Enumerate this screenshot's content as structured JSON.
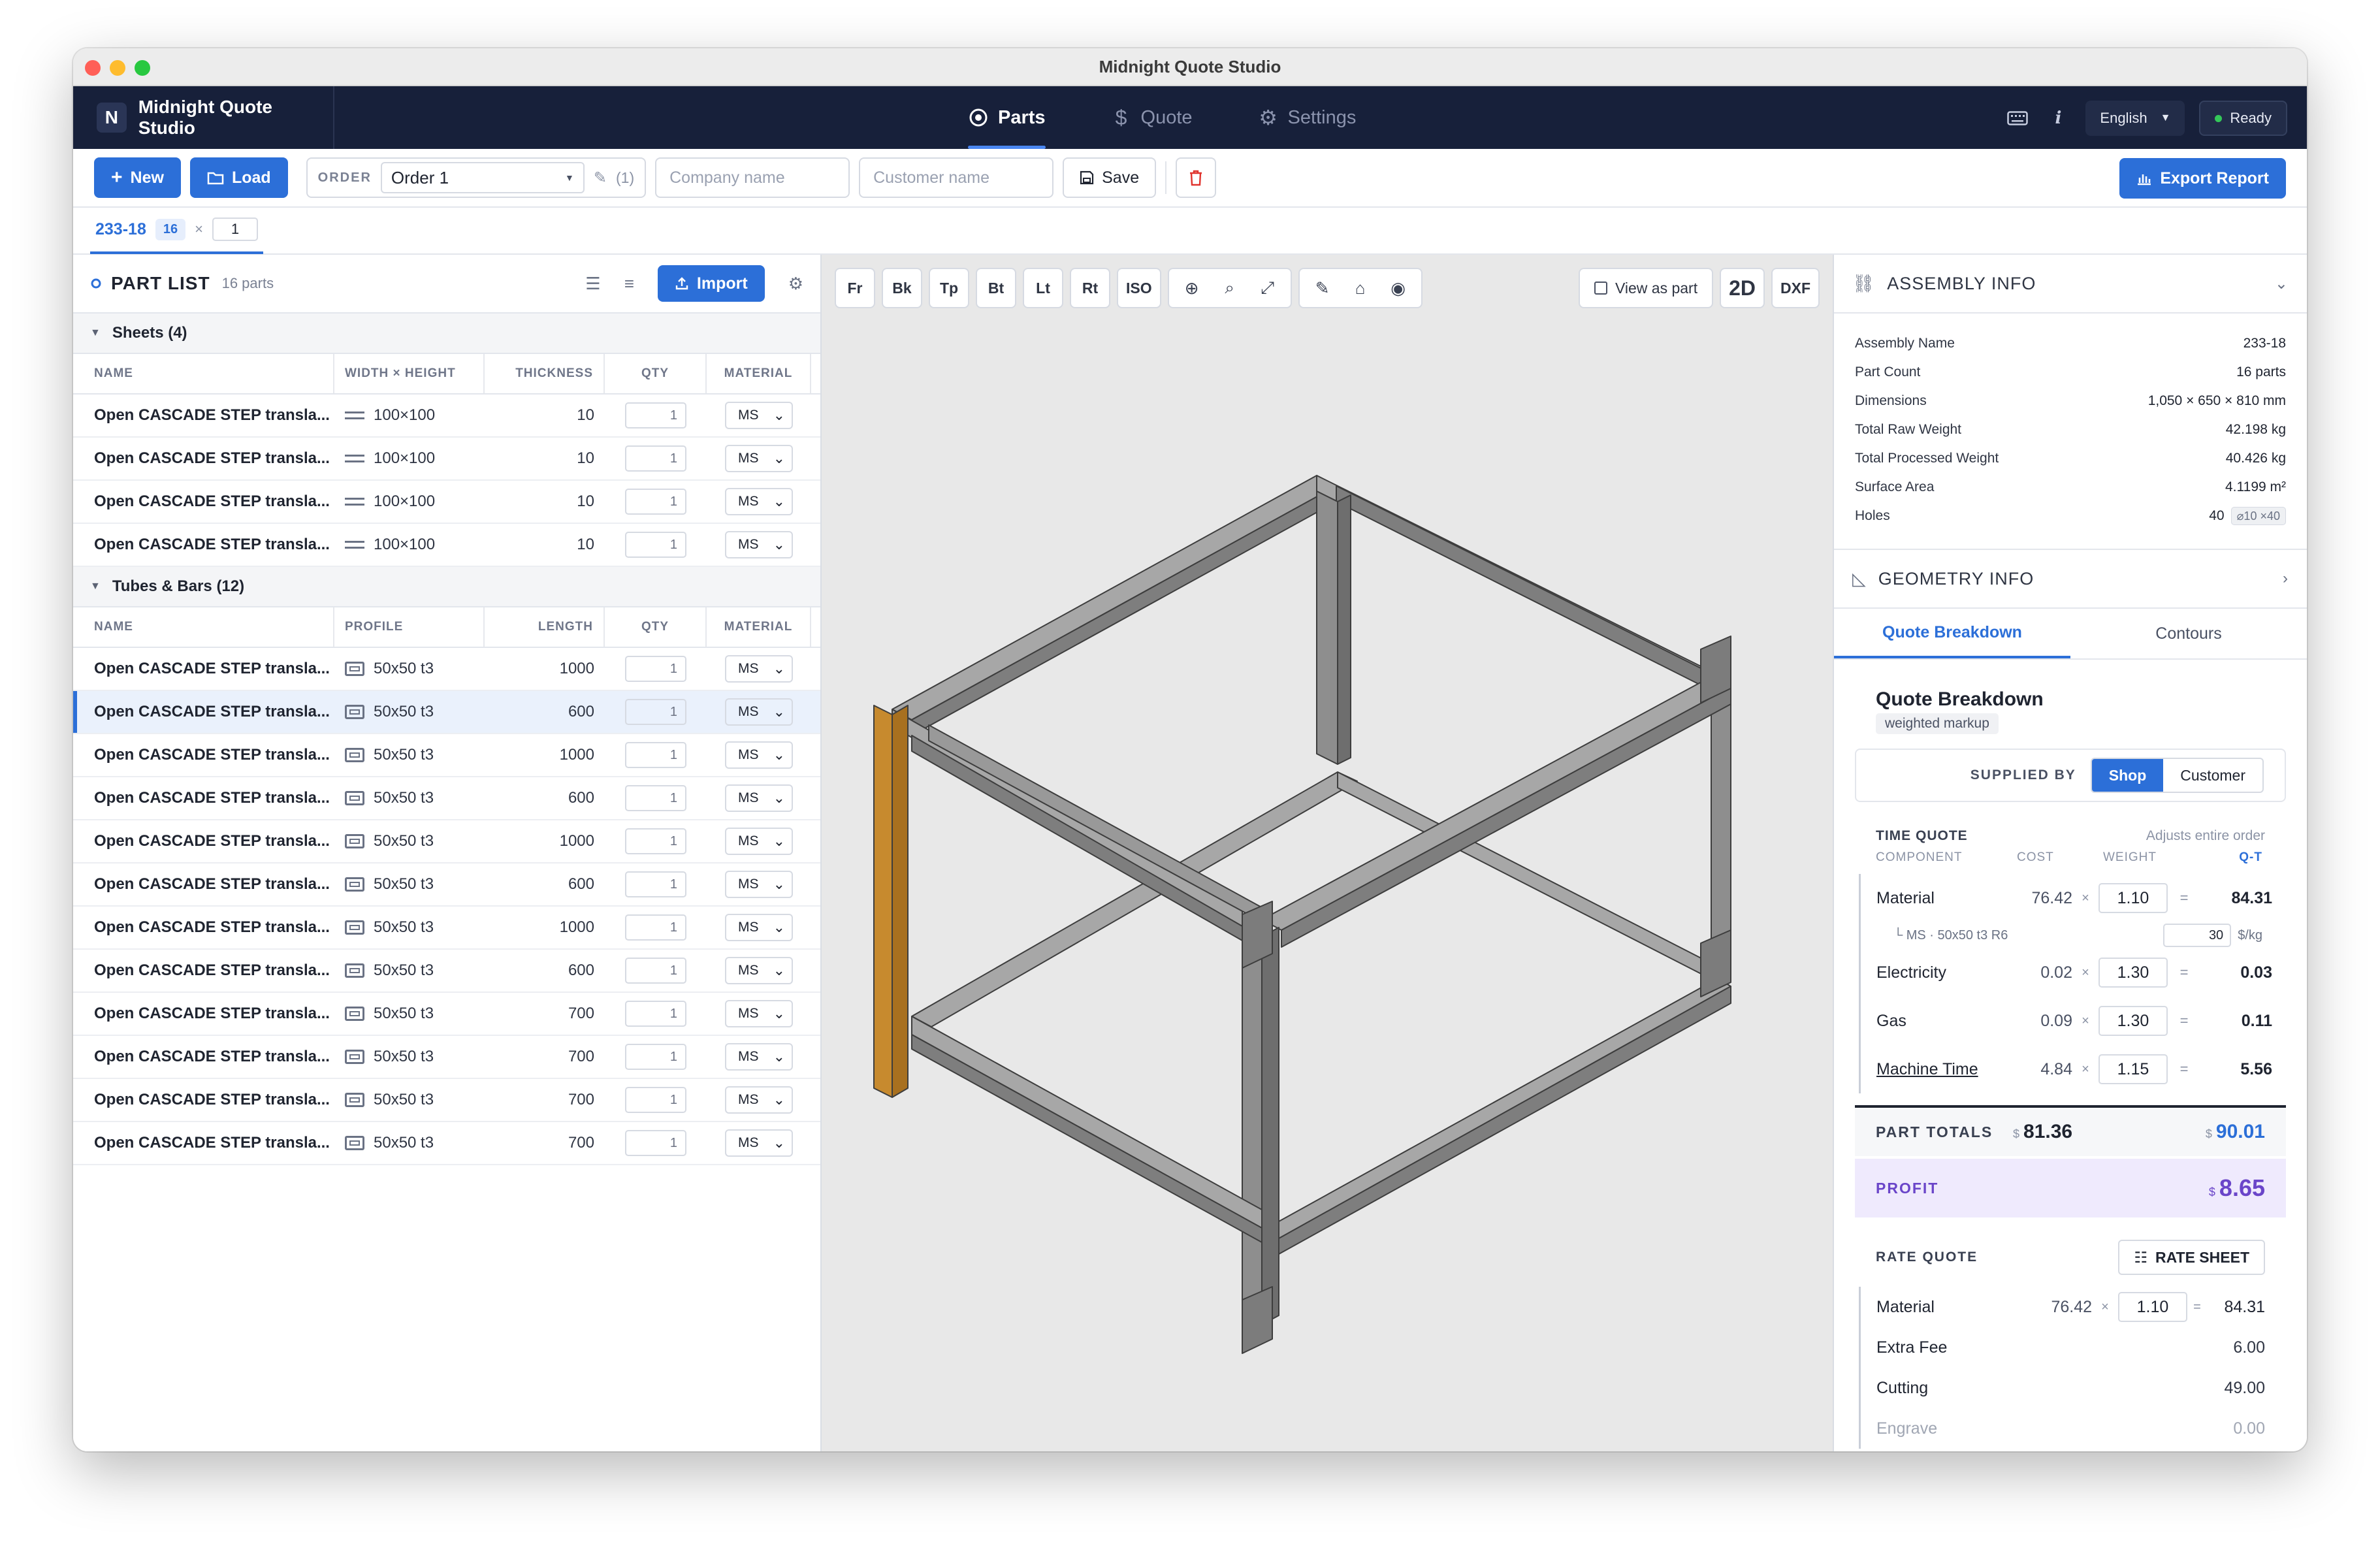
{
  "window": {
    "title": "Midnight Quote Studio",
    "traffic": {
      "close": "#ff5f57",
      "minimize": "#febc2e",
      "zoom": "#28c840"
    }
  },
  "header": {
    "app_name": "Midnight Quote Studio",
    "logo_glyph": "N",
    "tabs": [
      {
        "label": "Parts",
        "icon": "target-icon"
      },
      {
        "label": "Quote",
        "icon": "dollar-icon"
      },
      {
        "label": "Settings",
        "icon": "gear-icon"
      }
    ],
    "info_glyph": "i",
    "language": "English",
    "status": "Ready",
    "colors": {
      "bg": "#17203a",
      "accent": "#4a86f0",
      "status_dot": "#34c759"
    }
  },
  "toolbar": {
    "new_label": "New",
    "load_label": "Load",
    "order_label": "ORDER",
    "order_value": "Order 1",
    "order_count": "(1)",
    "company_placeholder": "Company name",
    "customer_placeholder": "Customer name",
    "save_label": "Save",
    "export_label": "Export Report"
  },
  "assembly_tab": {
    "name": "233-18",
    "badge": "16",
    "times": "×",
    "qty": "1"
  },
  "part_list": {
    "title": "PART LIST",
    "count": "16 parts",
    "import_label": "Import",
    "sheets": {
      "title": "Sheets (4)",
      "columns": [
        "NAME",
        "WIDTH × HEIGHT",
        "THICKNESS",
        "QTY",
        "MATERIAL"
      ],
      "rows": [
        {
          "name": "Open CASCADE STEP transla...",
          "dim": "100×100",
          "num": "10",
          "qty": "1",
          "material": "MS"
        },
        {
          "name": "Open CASCADE STEP transla...",
          "dim": "100×100",
          "num": "10",
          "qty": "1",
          "material": "MS"
        },
        {
          "name": "Open CASCADE STEP transla...",
          "dim": "100×100",
          "num": "10",
          "qty": "1",
          "material": "MS"
        },
        {
          "name": "Open CASCADE STEP transla...",
          "dim": "100×100",
          "num": "10",
          "qty": "1",
          "material": "MS"
        }
      ]
    },
    "tubes": {
      "title": "Tubes & Bars (12)",
      "columns": [
        "NAME",
        "PROFILE",
        "LENGTH",
        "QTY",
        "MATERIAL"
      ],
      "rows": [
        {
          "name": "Open CASCADE STEP transla...",
          "dim": "50x50 t3",
          "num": "1000",
          "qty": "1",
          "material": "MS"
        },
        {
          "name": "Open CASCADE STEP transla...",
          "dim": "50x50 t3",
          "num": "600",
          "qty": "1",
          "material": "MS",
          "selected": true
        },
        {
          "name": "Open CASCADE STEP transla...",
          "dim": "50x50 t3",
          "num": "1000",
          "qty": "1",
          "material": "MS"
        },
        {
          "name": "Open CASCADE STEP transla...",
          "dim": "50x50 t3",
          "num": "600",
          "qty": "1",
          "material": "MS"
        },
        {
          "name": "Open CASCADE STEP transla...",
          "dim": "50x50 t3",
          "num": "1000",
          "qty": "1",
          "material": "MS"
        },
        {
          "name": "Open CASCADE STEP transla...",
          "dim": "50x50 t3",
          "num": "600",
          "qty": "1",
          "material": "MS"
        },
        {
          "name": "Open CASCADE STEP transla...",
          "dim": "50x50 t3",
          "num": "1000",
          "qty": "1",
          "material": "MS"
        },
        {
          "name": "Open CASCADE STEP transla...",
          "dim": "50x50 t3",
          "num": "600",
          "qty": "1",
          "material": "MS"
        },
        {
          "name": "Open CASCADE STEP transla...",
          "dim": "50x50 t3",
          "num": "700",
          "qty": "1",
          "material": "MS"
        },
        {
          "name": "Open CASCADE STEP transla...",
          "dim": "50x50 t3",
          "num": "700",
          "qty": "1",
          "material": "MS"
        },
        {
          "name": "Open CASCADE STEP transla...",
          "dim": "50x50 t3",
          "num": "700",
          "qty": "1",
          "material": "MS"
        },
        {
          "name": "Open CASCADE STEP transla...",
          "dim": "50x50 t3",
          "num": "700",
          "qty": "1",
          "material": "MS"
        }
      ]
    }
  },
  "viewport": {
    "views": [
      "Fr",
      "Bk",
      "Tp",
      "Bt",
      "Lt",
      "Rt",
      "ISO"
    ],
    "view_as_part": "View as part",
    "mode_2d": "2D",
    "dxf": "DXF",
    "colors": {
      "beam": "#8e8e8e",
      "beam_dark": "#6e6e6e",
      "beam_light": "#a7a7a7",
      "selected": "#c78a2e",
      "edge": "#3d3d3d"
    }
  },
  "assembly_info": {
    "title": "ASSEMBLY INFO",
    "rows": [
      {
        "label": "Assembly Name",
        "value": "233-18"
      },
      {
        "label": "Part Count",
        "value": "16 parts"
      },
      {
        "label": "Dimensions",
        "value": "1,050 × 650 × 810 mm"
      },
      {
        "label": "Total Raw Weight",
        "value": "42.198 kg"
      },
      {
        "label": "Total Processed Weight",
        "value": "40.426 kg"
      },
      {
        "label": "Surface Area",
        "value": "4.1199 m²"
      },
      {
        "label": "Holes",
        "value": "40",
        "chip": "⌀10 ×40"
      }
    ]
  },
  "geometry_info": {
    "title": "GEOMETRY INFO"
  },
  "quote": {
    "tabs": [
      "Quote Breakdown",
      "Contours"
    ],
    "title": "Quote Breakdown",
    "subtitle": "weighted markup",
    "supplied_by": "SUPPLIED BY",
    "supplied_options": [
      "Shop",
      "Customer"
    ],
    "time_quote": "TIME QUOTE",
    "adjusts": "Adjusts entire order",
    "columns": [
      "COMPONENT",
      "COST",
      "WEIGHT",
      "Q-T"
    ],
    "rows": [
      {
        "name": "Material",
        "cost": "76.42",
        "weight": "1.10",
        "total": "84.31"
      },
      {
        "name": "Electricity",
        "cost": "0.02",
        "weight": "1.30",
        "total": "0.03"
      },
      {
        "name": "Gas",
        "cost": "0.09",
        "weight": "1.30",
        "total": "0.11"
      },
      {
        "name": "Machine Time",
        "cost": "4.84",
        "weight": "1.15",
        "total": "5.56"
      }
    ],
    "material_sub": "└ MS · 50x50 t3 R6",
    "material_rate": "30",
    "rate_unit": "$/kg",
    "multiply": "×",
    "equals": "=",
    "part_totals": "PART TOTALS",
    "currency": "$",
    "total_cost": "81.36",
    "total_quote": "90.01",
    "profit_label": "PROFIT",
    "profit_value": "8.65",
    "rate_quote": "RATE QUOTE",
    "rate_sheet": "RATE SHEET",
    "rate_material": {
      "name": "Material",
      "cost": "76.42",
      "weight": "1.10",
      "total": "84.31"
    },
    "rate_rows": [
      {
        "name": "Extra Fee",
        "value": "6.00"
      },
      {
        "name": "Cutting",
        "value": "49.00"
      },
      {
        "name": "Engrave",
        "value": "0.00"
      }
    ]
  }
}
